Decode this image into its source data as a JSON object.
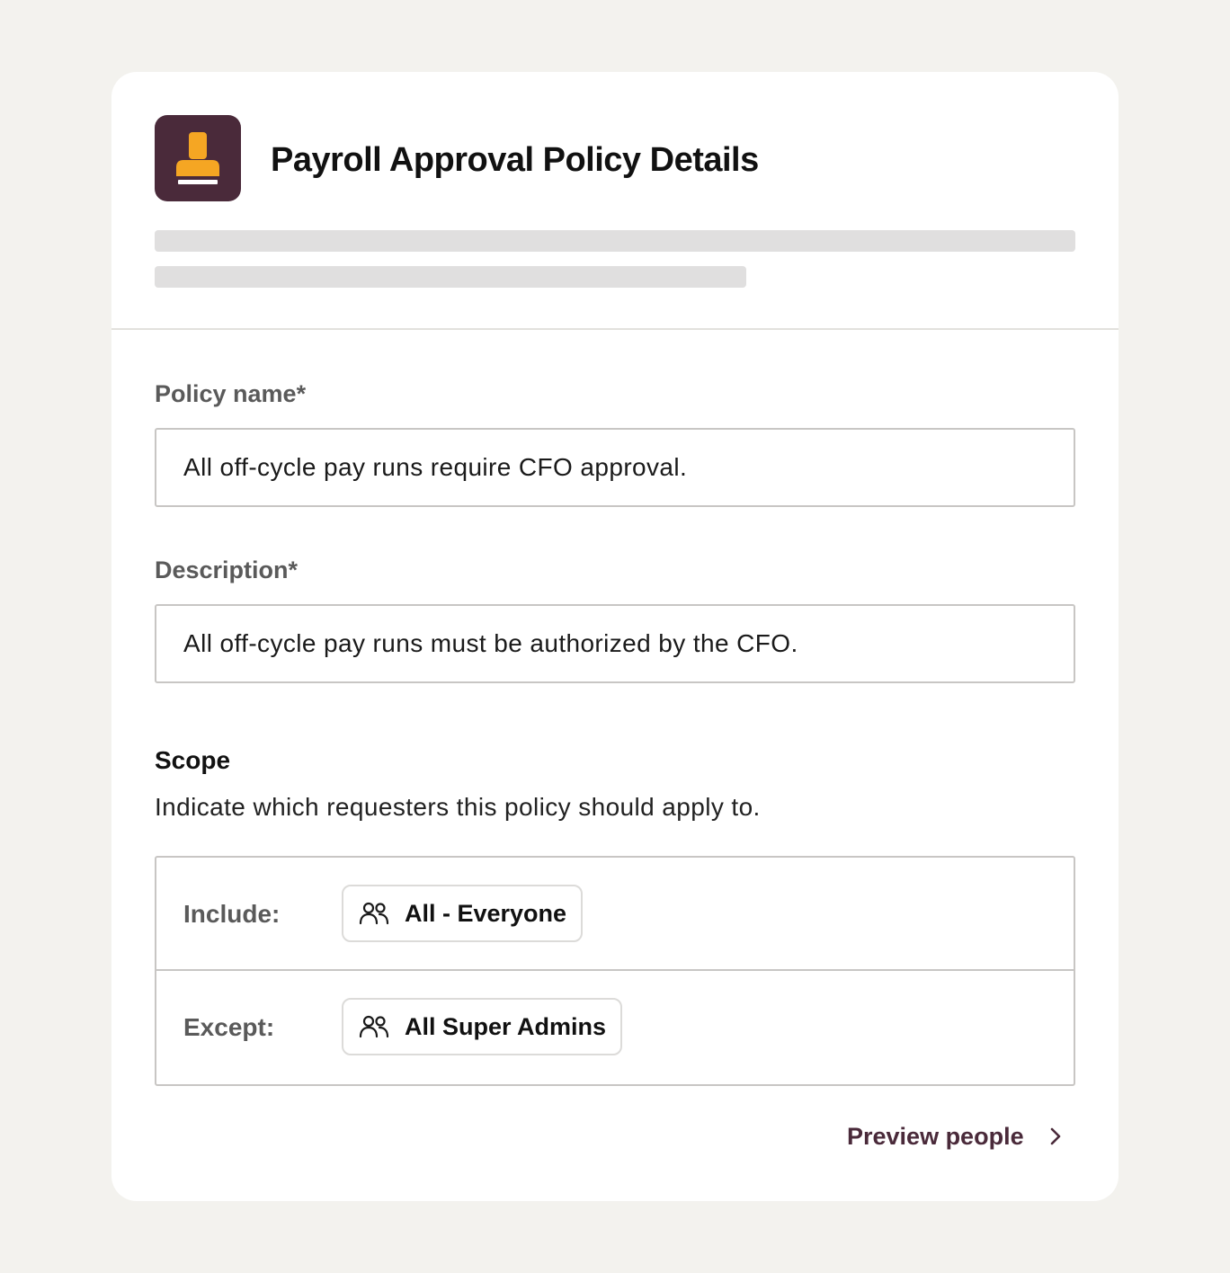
{
  "header": {
    "title": "Payroll Approval Policy Details",
    "icon": "stamp-icon",
    "icon_bg_color": "#4a2a3a",
    "icon_fg_color": "#f5a623"
  },
  "form": {
    "policy_name": {
      "label": "Policy name*",
      "value": "All off-cycle pay runs require CFO approval."
    },
    "description": {
      "label": "Description*",
      "value": "All off-cycle pay runs must be authorized by the CFO."
    }
  },
  "scope": {
    "title": "Scope",
    "description": "Indicate which requesters this policy should apply to.",
    "rows": [
      {
        "label": "Include:",
        "chip": "All - Everyone",
        "icon": "people-icon"
      },
      {
        "label": "Except:",
        "chip": "All Super Admins",
        "icon": "people-icon"
      }
    ]
  },
  "actions": {
    "preview_label": "Preview people",
    "preview_icon": "chevron-right-icon",
    "accent_color": "#4a2a3a"
  }
}
